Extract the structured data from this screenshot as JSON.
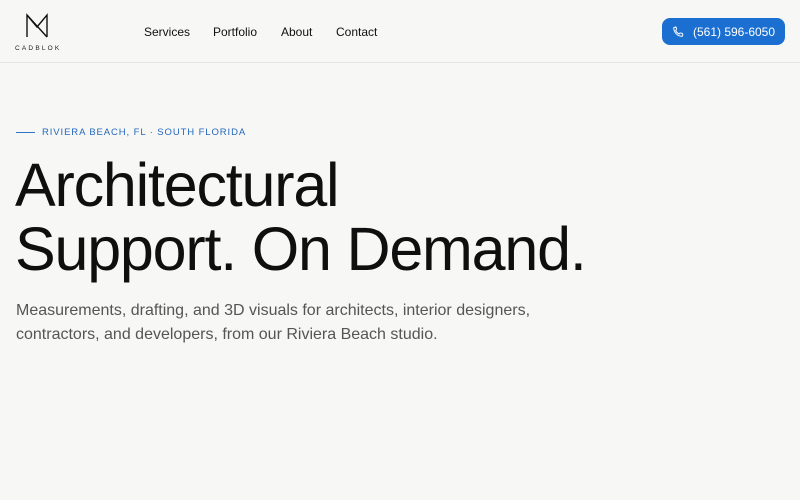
{
  "header": {
    "logo_text": "CADBLOK",
    "nav": [
      "Services",
      "Portfolio",
      "About",
      "Contact"
    ],
    "phone_label": "(561) 596-6050",
    "phone_icon": "phone-icon",
    "accent_color": "#1a6fd1"
  },
  "hero": {
    "eyebrow": "RIVIERA BEACH, FL · SOUTH FLORIDA",
    "headline_line1": "Architectural",
    "headline_line2": "Support. On Demand.",
    "subtitle": "Measurements, drafting, and 3D visuals for architects, interior designers, contractors, and developers, from our Riviera Beach studio."
  }
}
